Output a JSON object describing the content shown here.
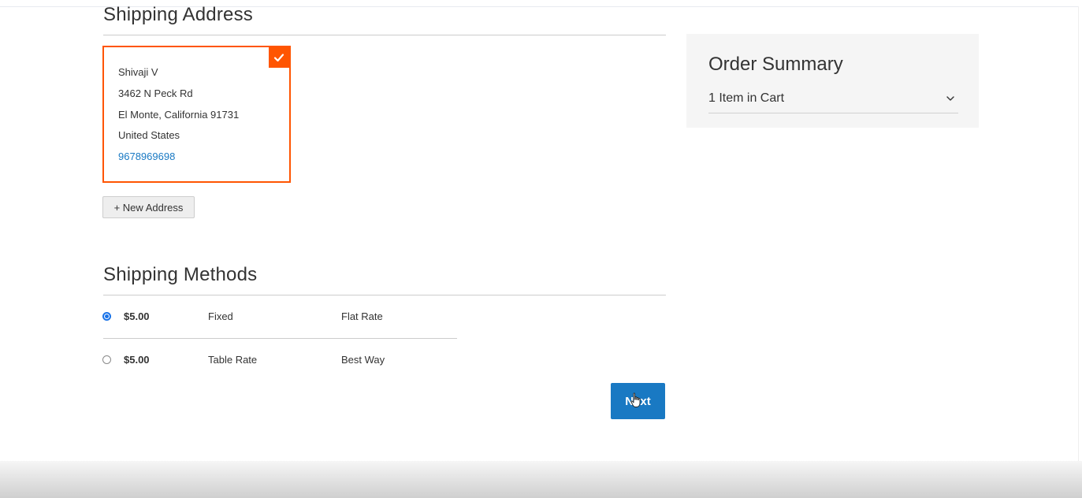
{
  "shipping_address": {
    "title": "Shipping Address",
    "selected_address": {
      "name": "Shivaji V",
      "street": "3462 N Peck Rd",
      "city_region_zip": "El Monte, California 91731",
      "country": "United States",
      "phone": "9678969698",
      "selected_icon": "checkmark-icon"
    },
    "new_address_label": "+ New Address"
  },
  "shipping_methods": {
    "title": "Shipping Methods",
    "rows": [
      {
        "selected": true,
        "price": "$5.00",
        "method": "Fixed",
        "carrier": "Flat Rate"
      },
      {
        "selected": false,
        "price": "$5.00",
        "method": "Table Rate",
        "carrier": "Best Way"
      }
    ],
    "next_label": "Next"
  },
  "order_summary": {
    "title": "Order Summary",
    "items_in_cart": "1 Item in Cart",
    "toggle_icon": "chevron-down-icon"
  },
  "colors": {
    "selected_border": "#ff5501",
    "primary_button": "#1979c3",
    "link": "#1979c3",
    "summary_background": "#f5f5f5"
  }
}
